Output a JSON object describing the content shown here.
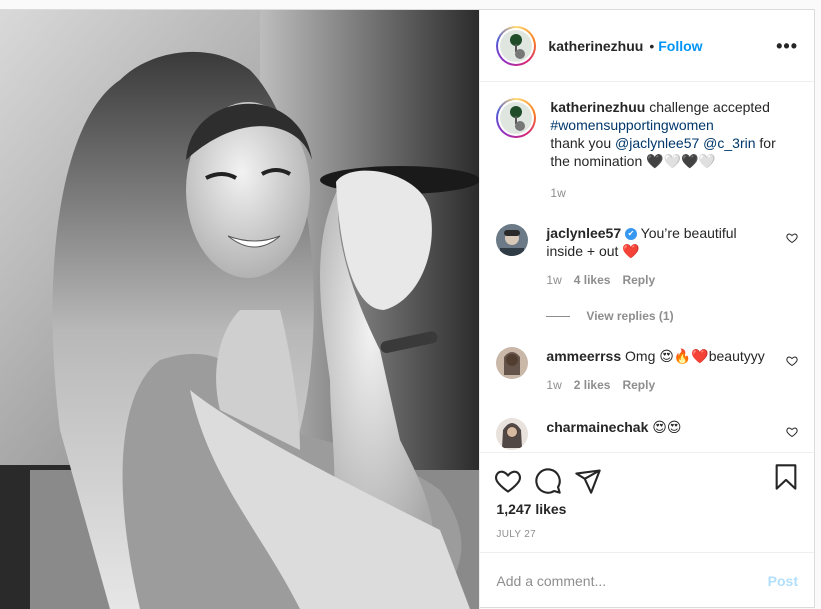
{
  "post": {
    "username": "katherinezhuu",
    "dot": "•",
    "follow_label": "Follow",
    "more_label": "•••",
    "caption": {
      "username": "katherinezhuu",
      "text_a": " challenge accepted",
      "hashtag": "#womensupportingwomen",
      "text_b": "thank you ",
      "mention1": "@jaclynlee57",
      "space": " ",
      "mention2": "@c_3rin",
      "text_c": " for the nomination ",
      "emojis": "🖤🤍🖤🤍",
      "time": "1w"
    },
    "comments": [
      {
        "username": "jaclynlee57",
        "verified": "✔",
        "text": " You’re beautiful inside + out ",
        "emoji": "❤️",
        "time": "1w",
        "likes": "4 likes",
        "reply": "Reply",
        "view_replies": "View replies (1)"
      },
      {
        "username": "ammeerrss",
        "text": " Omg ",
        "emoji": "😍🔥❤️",
        "text2": "beautyyy",
        "time": "1w",
        "likes": "2 likes",
        "reply": "Reply"
      },
      {
        "username": "charmainechak",
        "text": " ",
        "emoji": "😍😍"
      }
    ],
    "likes_count": "1,247 likes",
    "date": "JULY 27",
    "add_comment_placeholder": "Add a comment...",
    "post_button": "Post"
  },
  "colors": {
    "accent": "#0095f6",
    "muted": "#8e8e8e",
    "link": "#00376b",
    "verified": "#3897f0"
  },
  "icons": [
    "more-icon",
    "heart-icon",
    "comment-icon",
    "share-icon",
    "bookmark-icon",
    "verified-icon"
  ]
}
